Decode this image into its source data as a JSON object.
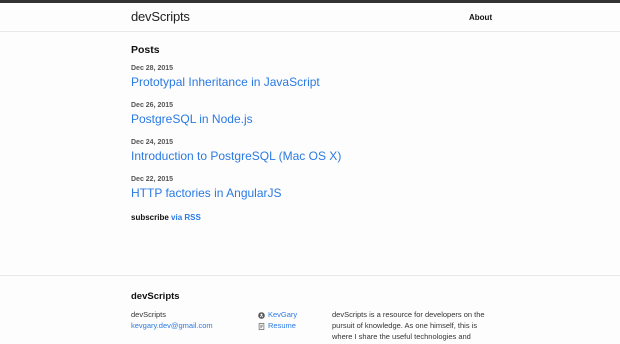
{
  "header": {
    "site_title": "devScripts",
    "nav": [
      {
        "label": "About"
      }
    ]
  },
  "main": {
    "section_title": "Posts",
    "posts": [
      {
        "date": "Dec 28, 2015",
        "title": "Prototypal Inheritance in JavaScript"
      },
      {
        "date": "Dec 26, 2015",
        "title": "PostgreSQL in Node.js"
      },
      {
        "date": "Dec 24, 2015",
        "title": "Introduction to PostgreSQL (Mac OS X)"
      },
      {
        "date": "Dec 22, 2015",
        "title": "HTTP factories in AngularJS"
      }
    ],
    "subscribe_label": "subscribe",
    "subscribe_link": "via RSS"
  },
  "footer": {
    "heading": "devScripts",
    "name": "devScripts",
    "email": "kevgary.dev@gmail.com",
    "github_label": "KevGary",
    "resume_label": "Resume",
    "description": "devScripts is a resource for developers on the pursuit of knowledge. As one himself, this is where I share the useful technologies and"
  },
  "colors": {
    "link": "#2a7ae2",
    "top_bar": "#333333"
  },
  "icons": {
    "github": "github-icon",
    "resume": "document-icon"
  }
}
